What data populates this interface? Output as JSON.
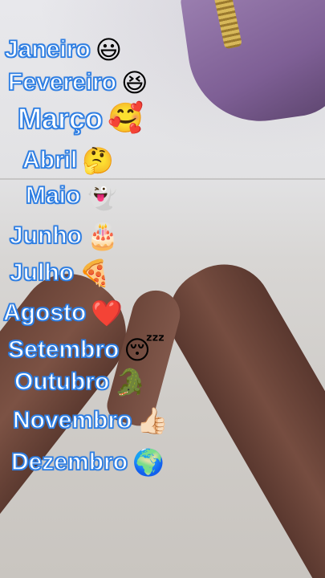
{
  "months": [
    {
      "label": "Janeiro",
      "emoji": "😃",
      "emoji_name": "grinning-face-icon"
    },
    {
      "label": "Fevereiro",
      "emoji": "😆",
      "emoji_name": "laughing-face-icon"
    },
    {
      "label": "Março",
      "emoji": "🥰",
      "emoji_name": "smiling-face-hearts-icon"
    },
    {
      "label": "Abril",
      "emoji": "🤔",
      "emoji_name": "thinking-face-icon"
    },
    {
      "label": "Maio",
      "emoji": "👻",
      "emoji_name": "ghost-icon"
    },
    {
      "label": "Junho",
      "emoji": "🎂",
      "emoji_name": "birthday-cake-icon"
    },
    {
      "label": "Julho",
      "emoji": "🍕",
      "emoji_name": "pizza-icon"
    },
    {
      "label": "Agosto",
      "emoji": "❤️",
      "emoji_name": "red-heart-icon"
    },
    {
      "label": "Setembro",
      "emoji": "😴",
      "emoji_name": "sleeping-face-icon"
    },
    {
      "label": "Outubro",
      "emoji": "🐊",
      "emoji_name": "crocodile-icon"
    },
    {
      "label": "Novembro",
      "emoji": "👍🏻",
      "emoji_name": "thumbs-up-icon"
    },
    {
      "label": "Dezembro",
      "emoji": "🌍",
      "emoji_name": "globe-icon"
    }
  ],
  "colors": {
    "text_fill": "#ffffff",
    "text_outline": "#2f7fe3"
  }
}
